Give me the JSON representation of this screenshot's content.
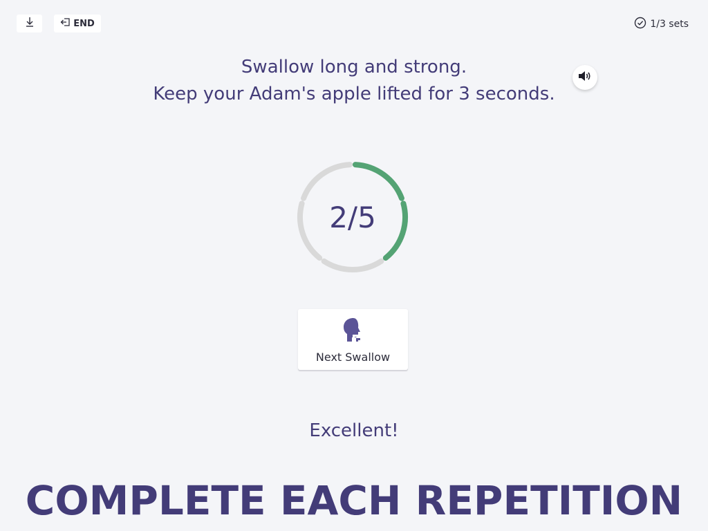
{
  "toolbar": {
    "collapse_icon": "collapse-down-icon",
    "end_label": "END",
    "end_icon": "exit-icon"
  },
  "progress": {
    "sets_label": "1/3 sets",
    "sets_icon": "check-circle-icon"
  },
  "instructions": {
    "line1": "Swallow long and strong.",
    "line2": "Keep your Adam's apple lifted for 3 seconds."
  },
  "audio": {
    "icon": "speaker-icon"
  },
  "counter": {
    "label": "2/5",
    "completed": 2,
    "total": 5,
    "complete_color": "#54a374",
    "remaining_color": "#d9d9d9"
  },
  "next_button": {
    "label": "Next Swallow",
    "icon": "head-throat-icon",
    "icon_color": "#5b5497"
  },
  "feedback": "Excellent!",
  "banner": "COMPLETE EACH REPETITION"
}
